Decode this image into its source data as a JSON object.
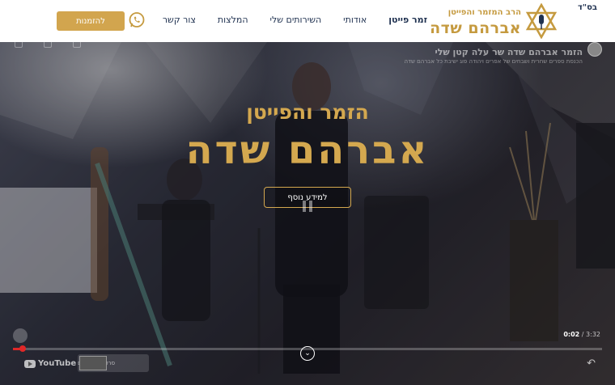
{
  "header": {
    "bsd": "בס\"ד",
    "logo_subtitle": "הרב המזמר והפייטן",
    "logo_title": "אברהם שדה",
    "nav": [
      {
        "label": "זמר פייטן",
        "active": true
      },
      {
        "label": "אודותי",
        "active": false
      },
      {
        "label": "השירותים שלי",
        "active": false
      },
      {
        "label": "המלצות",
        "active": false
      },
      {
        "label": "צור קשר",
        "active": false
      }
    ],
    "cta_label": "להזמנות",
    "icons": {
      "whatsapp": "whatsapp-icon",
      "star": "star-of-david-icon"
    }
  },
  "video": {
    "title": "הזמר אברהם שדה שר עלה קטן שלי",
    "subtitle": "הכנסת ספרים שחרית ושבחים של אפרים ויהודה פוג ישיבת כל אברהם שדה",
    "time_current": "0:02",
    "time_total": "3:32",
    "progress": 0.01,
    "youtube_label": "YouTube",
    "related_label": "סרטונים נוספים"
  },
  "hero": {
    "subtitle": "הזמר והפייטן",
    "title": "אברהם שדה",
    "more_button": "למידע נוסף"
  },
  "colors": {
    "gold": "#d4a84f",
    "navy": "#1f3150",
    "progress": "#e02828"
  }
}
